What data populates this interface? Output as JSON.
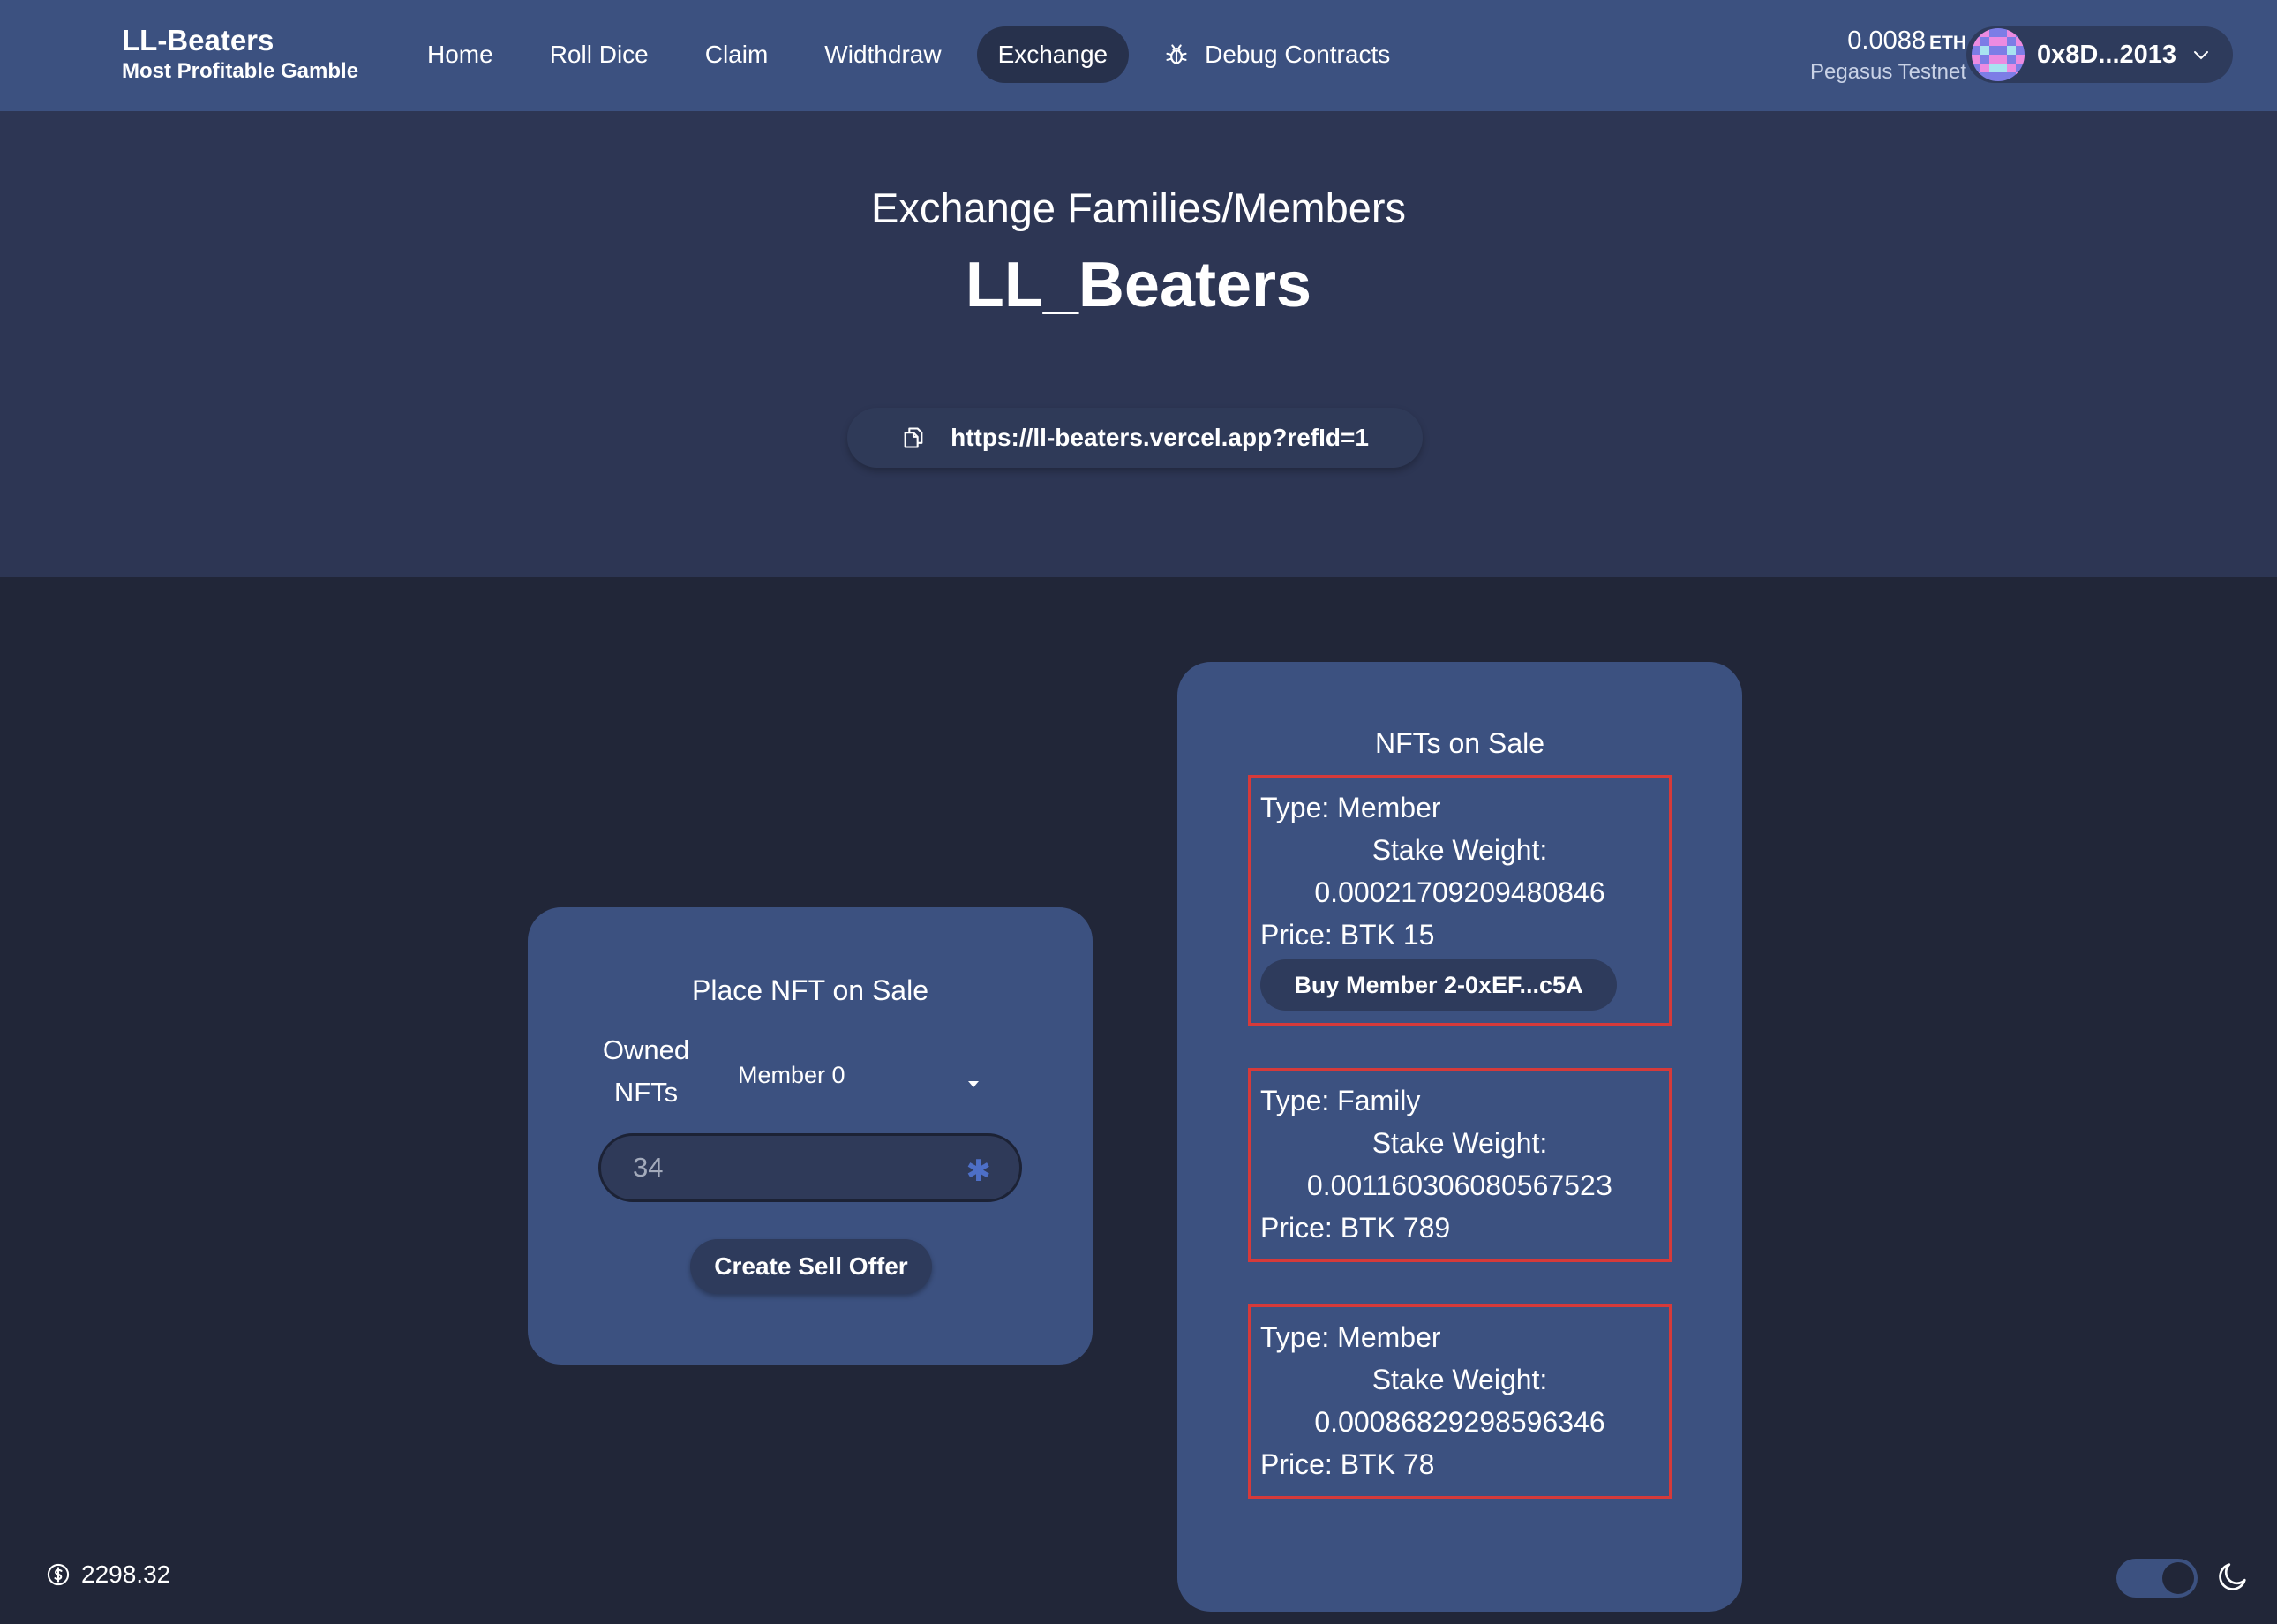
{
  "brand": {
    "title": "LL-Beaters",
    "subtitle": "Most Profitable Gamble"
  },
  "nav": {
    "items": [
      {
        "label": "Home"
      },
      {
        "label": "Roll Dice"
      },
      {
        "label": "Claim"
      },
      {
        "label": "Widthdraw"
      },
      {
        "label": "Exchange",
        "active": true
      },
      {
        "label": "Debug Contracts",
        "icon": "bug-icon"
      }
    ]
  },
  "wallet": {
    "balance": "0.0088",
    "unit": "ETH",
    "network": "Pegasus Testnet",
    "address": "0x8D...2013"
  },
  "hero": {
    "subtitle": "Exchange Families/Members",
    "title": "LL_Beaters",
    "ref_link": "https://ll-beaters.vercel.app?refId=1"
  },
  "place_sale": {
    "title": "Place NFT on Sale",
    "owned_label": "Owned NFTs",
    "selected_nft": "Member 0",
    "amount_value": "34",
    "create_button": "Create Sell Offer"
  },
  "nfts_on_sale": {
    "title": "NFTs on Sale",
    "offers": [
      {
        "type": "Type: Member",
        "stake_label": "Stake Weight:",
        "stake_value": "0.00021709209480846",
        "price": "Price: BTK 15",
        "buy_label": "Buy Member 2-0xEF...c5A"
      },
      {
        "type": "Type: Family",
        "stake_label": "Stake Weight:",
        "stake_value": "0.00116030608056752З",
        "price": "Price: BTK 789"
      },
      {
        "type": "Type: Member",
        "stake_label": "Stake Weight:",
        "stake_value": "0.00086829298596346",
        "price": "Price: BTK 78"
      }
    ]
  },
  "footer": {
    "native_price": "2298.32"
  },
  "colors": {
    "navbar": "#3c5180",
    "hero": "#2d3654",
    "background": "#212638",
    "card": "#3c5180",
    "offer_border": "#d63a3a"
  }
}
